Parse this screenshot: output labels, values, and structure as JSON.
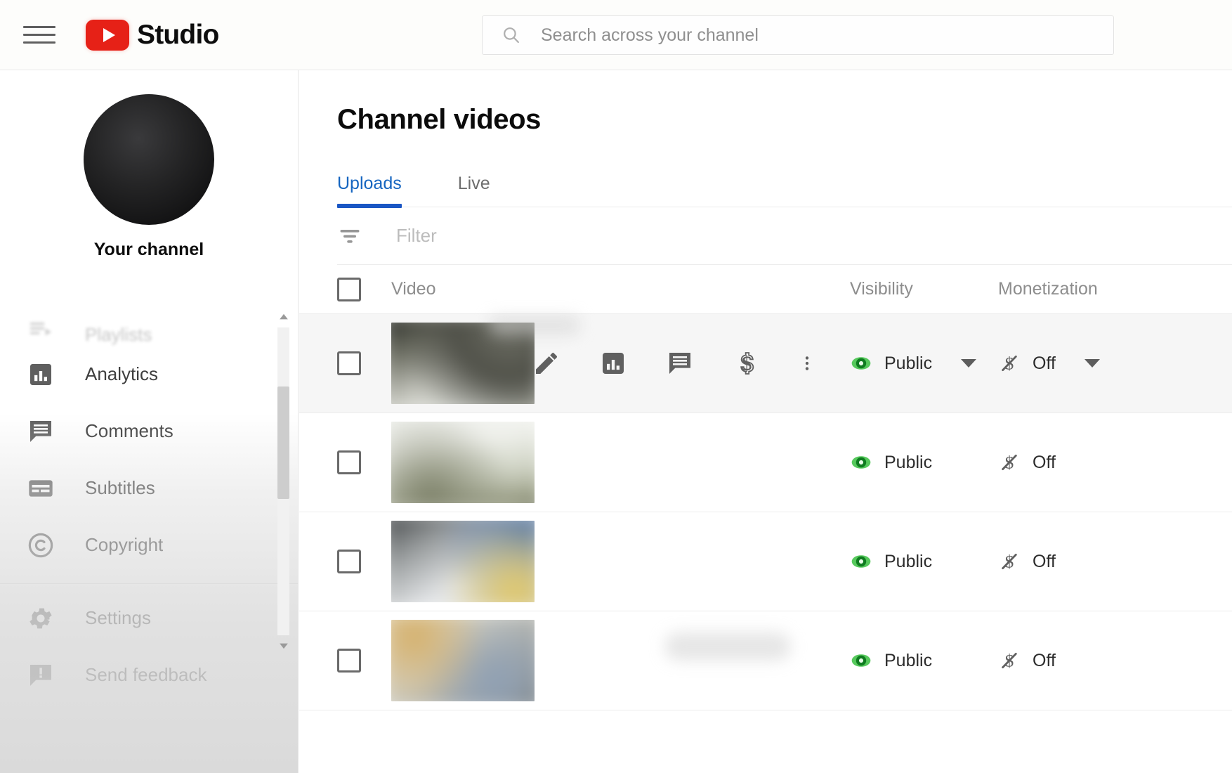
{
  "header": {
    "menu_label": "Menu",
    "brand_text": "Studio",
    "logo_name": "youtube-logo",
    "search": {
      "placeholder": "Search across your channel",
      "value": "",
      "icon": "search-icon"
    }
  },
  "sidebar": {
    "channel_label": "Your channel",
    "avatar_name": "channel-avatar",
    "items": [
      {
        "label": "Playlists",
        "icon": "playlists-icon",
        "state": "clipped"
      },
      {
        "label": "Analytics",
        "icon": "analytics-icon",
        "state": "normal"
      },
      {
        "label": "Comments",
        "icon": "comments-icon",
        "state": "normal"
      },
      {
        "label": "Subtitles",
        "icon": "subtitles-icon",
        "state": "normal"
      },
      {
        "label": "Copyright",
        "icon": "copyright-icon",
        "state": "normal"
      }
    ],
    "bottom_items": [
      {
        "label": "Settings",
        "icon": "gear-icon"
      },
      {
        "label": "Send feedback",
        "icon": "feedback-icon"
      }
    ],
    "scrollbar": {
      "up": "chevron-up-icon",
      "down": "chevron-down-icon"
    }
  },
  "main": {
    "title": "Channel videos",
    "tabs": [
      {
        "label": "Uploads",
        "active": true
      },
      {
        "label": "Live",
        "active": false
      }
    ],
    "filter": {
      "placeholder": "Filter",
      "value": "",
      "icon": "filter-icon"
    },
    "table": {
      "columns": {
        "select_all": "",
        "video": "Video",
        "visibility": "Visibility",
        "monetization": "Monetization"
      },
      "hover_actions": [
        {
          "label": "Details",
          "icon": "pencil-icon"
        },
        {
          "label": "Analytics",
          "icon": "analytics-icon"
        },
        {
          "label": "Comments",
          "icon": "comments-icon"
        },
        {
          "label": "Monetization",
          "icon": "dollar-icon"
        },
        {
          "label": "More options",
          "icon": "kebab-icon"
        }
      ],
      "rows": [
        {
          "title": "",
          "thumb_class": "thumb-a",
          "visibility": "Public",
          "visibility_icon": "eye-icon",
          "monetization": "Off",
          "monetization_icon": "dollar-off-icon",
          "hovered": true,
          "has_caret": true
        },
        {
          "title": "",
          "thumb_class": "thumb-b",
          "visibility": "Public",
          "visibility_icon": "eye-icon",
          "monetization": "Off",
          "monetization_icon": "dollar-off-icon",
          "hovered": false,
          "has_caret": false
        },
        {
          "title": "",
          "thumb_class": "thumb-c",
          "visibility": "Public",
          "visibility_icon": "eye-icon",
          "monetization": "Off",
          "monetization_icon": "dollar-off-icon",
          "hovered": false,
          "has_caret": false
        },
        {
          "title": "",
          "thumb_class": "thumb-d",
          "visibility": "Public",
          "visibility_icon": "eye-icon",
          "monetization": "Off",
          "monetization_icon": "dollar-off-icon",
          "hovered": false,
          "has_caret": false
        }
      ]
    }
  },
  "colors": {
    "brand_red": "#e62117",
    "tab_active_blue": "#1a56c4",
    "public_green": "#1e8e2f",
    "text_primary": "#030303",
    "text_secondary": "#8d8d8d"
  }
}
